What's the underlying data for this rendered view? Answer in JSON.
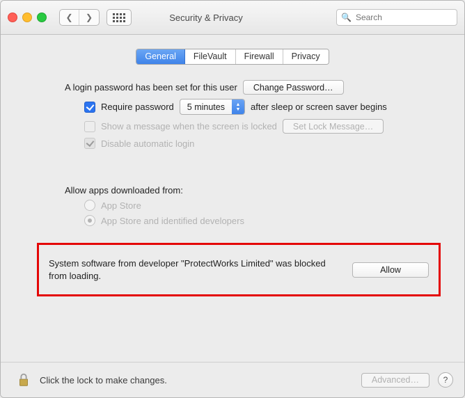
{
  "window": {
    "title": "Security & Privacy"
  },
  "search": {
    "placeholder": "Search"
  },
  "tabs": {
    "general": "General",
    "filevault": "FileVault",
    "firewall": "Firewall",
    "privacy": "Privacy"
  },
  "loginRow": {
    "text": "A login password has been set for this user",
    "button": "Change Password…"
  },
  "require": {
    "label_before": "Require password",
    "select_value": "5 minutes",
    "label_after": "after sleep or screen saver begins"
  },
  "showMsg": {
    "label": "Show a message when the screen is locked",
    "button": "Set Lock Message…"
  },
  "disableAuto": {
    "label": "Disable automatic login"
  },
  "allow": {
    "heading": "Allow apps downloaded from:",
    "opt1": "App Store",
    "opt2": "App Store and identified developers"
  },
  "block": {
    "message": "System software from developer \"ProtectWorks Limited\" was blocked from loading.",
    "button": "Allow"
  },
  "footer": {
    "lockmsg": "Click the lock to make changes.",
    "advanced": "Advanced…"
  }
}
